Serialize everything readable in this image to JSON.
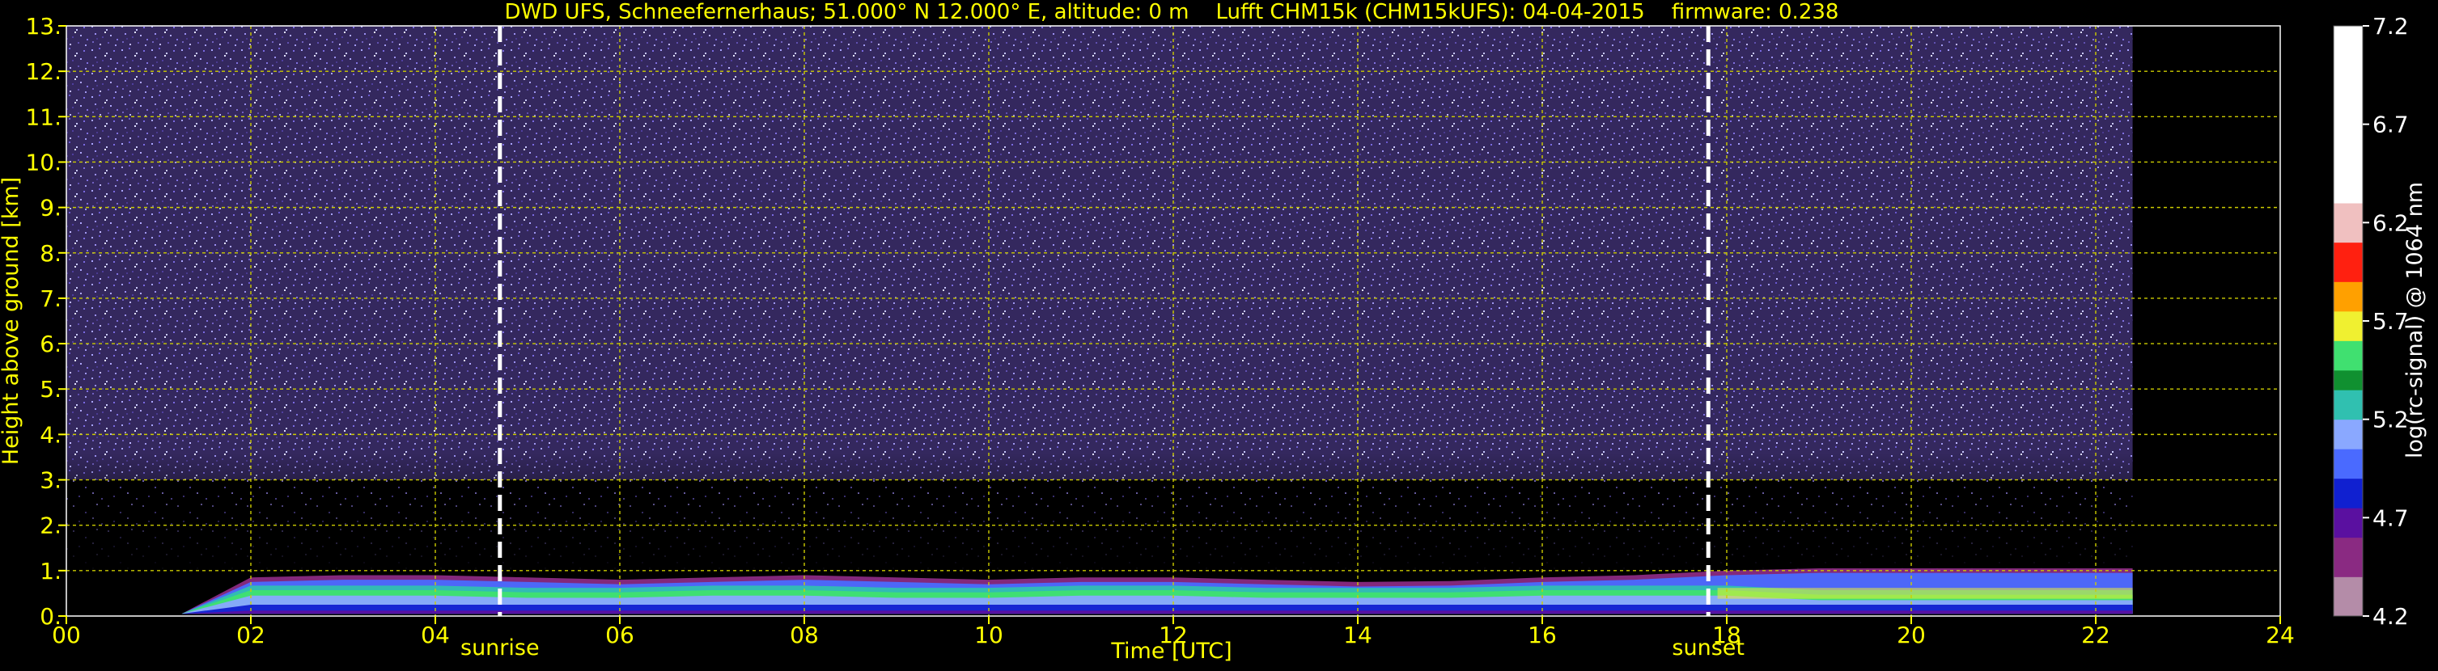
{
  "chart_data": {
    "type": "heatmap",
    "title": "DWD UFS, Schneefernerhaus; 51.000° N 12.000° E, altitude: 0 m    Lufft CHM15k (CHM15kUFS): 04-04-2015    firmware: 0.238",
    "xlabel": "Time [UTC]",
    "ylabel": "Height above ground [km]",
    "xlim": [
      0,
      24
    ],
    "ylim": [
      0,
      13
    ],
    "x_ticks": [
      "00",
      "02",
      "04",
      "06",
      "08",
      "10",
      "12",
      "14",
      "16",
      "18",
      "20",
      "22",
      "24"
    ],
    "x_tick_values": [
      0,
      2,
      4,
      6,
      8,
      10,
      12,
      14,
      16,
      18,
      20,
      22,
      24
    ],
    "y_ticks": [
      "0.",
      "1.",
      "2.",
      "3.",
      "4.",
      "5.",
      "6.",
      "7.",
      "8.",
      "9.",
      "10.",
      "11.",
      "12.",
      "13."
    ],
    "y_tick_values": [
      0,
      1,
      2,
      3,
      4,
      5,
      6,
      7,
      8,
      9,
      10,
      11,
      12,
      13
    ],
    "grid": true,
    "data_coverage_hours": [
      0,
      22.4
    ],
    "data_gap_hours": [
      0.95,
      1.25
    ],
    "sunrise_hour": 4.7,
    "sunset_hour": 17.8,
    "annotations": [
      {
        "text": "sunrise",
        "x": 4.7
      },
      {
        "text": "sunset",
        "x": 17.8
      }
    ],
    "aerosol_layer": {
      "hours": [
        0,
        1,
        2,
        3,
        4,
        5,
        6,
        7,
        8,
        9,
        10,
        11,
        12,
        13,
        14,
        15,
        16,
        17,
        18,
        19,
        20,
        21,
        22.4
      ],
      "top_km": [
        0.6,
        0.7,
        0.8,
        0.85,
        0.85,
        0.8,
        0.75,
        0.8,
        0.85,
        0.8,
        0.75,
        0.8,
        0.8,
        0.75,
        0.7,
        0.72,
        0.8,
        0.85,
        0.95,
        1.0,
        1.0,
        1.0,
        1.0
      ],
      "core_km": [
        0.5,
        0.5,
        0.55,
        0.55,
        0.55,
        0.5,
        0.5,
        0.55,
        0.55,
        0.5,
        0.5,
        0.55,
        0.55,
        0.5,
        0.5,
        0.5,
        0.55,
        0.55,
        0.55,
        0.45,
        0.45,
        0.45,
        0.45
      ]
    },
    "colorbar": {
      "label": "log(rc-signal) @ 1064 nm",
      "ticks": [
        "7.2",
        "6.7",
        "6.2",
        "5.7",
        "5.2",
        "4.7",
        "4.2"
      ],
      "tick_values": [
        7.2,
        6.7,
        6.2,
        5.7,
        5.2,
        4.7,
        4.2
      ],
      "range": [
        4.2,
        7.2
      ],
      "colors": [
        {
          "from": 4.2,
          "to": 4.4,
          "color": "#b48ca8"
        },
        {
          "from": 4.4,
          "to": 4.6,
          "color": "#8a2a82"
        },
        {
          "from": 4.6,
          "to": 4.75,
          "color": "#5a10a0"
        },
        {
          "from": 4.75,
          "to": 4.9,
          "color": "#1020d0"
        },
        {
          "from": 4.9,
          "to": 5.05,
          "color": "#4a6aff"
        },
        {
          "from": 5.05,
          "to": 5.2,
          "color": "#8aa8ff"
        },
        {
          "from": 5.2,
          "to": 5.35,
          "color": "#30c0b0"
        },
        {
          "from": 5.35,
          "to": 5.45,
          "color": "#109030"
        },
        {
          "from": 5.45,
          "to": 5.6,
          "color": "#40e070"
        },
        {
          "from": 5.6,
          "to": 5.75,
          "color": "#f0f030"
        },
        {
          "from": 5.75,
          "to": 5.9,
          "color": "#ffa000"
        },
        {
          "from": 5.9,
          "to": 6.1,
          "color": "#ff2010"
        },
        {
          "from": 6.1,
          "to": 6.3,
          "color": "#f0c0c0"
        },
        {
          "from": 6.3,
          "to": 7.2,
          "color": "#ffffff"
        }
      ]
    },
    "colors": {
      "axis_text": "#ffff00",
      "grid": "#cccc00",
      "background": "#000000",
      "colorbar_text": "#ffffff",
      "noise_base": "#3a2a6a",
      "marker": "#ffffff"
    }
  }
}
